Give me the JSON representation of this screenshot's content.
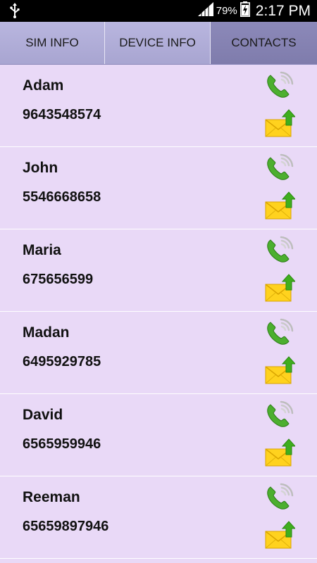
{
  "status_bar": {
    "battery_percent": "79%",
    "time": "2:17 PM",
    "icons": [
      "usb-icon",
      "signal-icon",
      "battery-charging-icon"
    ]
  },
  "tabs": [
    {
      "label": "SIM INFO",
      "selected": false
    },
    {
      "label": "DEVICE INFO",
      "selected": false
    },
    {
      "label": "CONTACTS",
      "selected": true
    }
  ],
  "contacts": [
    {
      "name": "Adam",
      "number": "9643548574"
    },
    {
      "name": "John",
      "number": "5546668658"
    },
    {
      "name": "Maria",
      "number": "675656599"
    },
    {
      "name": "Madan",
      "number": "6495929785"
    },
    {
      "name": "David",
      "number": "6565959946"
    },
    {
      "name": "Reeman",
      "number": "65659897946"
    }
  ],
  "icons": {
    "call": "phone-call-icon",
    "sms": "send-sms-icon"
  },
  "colors": {
    "background": "#e9d9f7",
    "tab_bar": "#b0addb",
    "tab_selected": "#8683b3",
    "call_green": "#4caf2f",
    "envelope_yellow": "#ffd21e",
    "arrow_green": "#3fae1e"
  }
}
